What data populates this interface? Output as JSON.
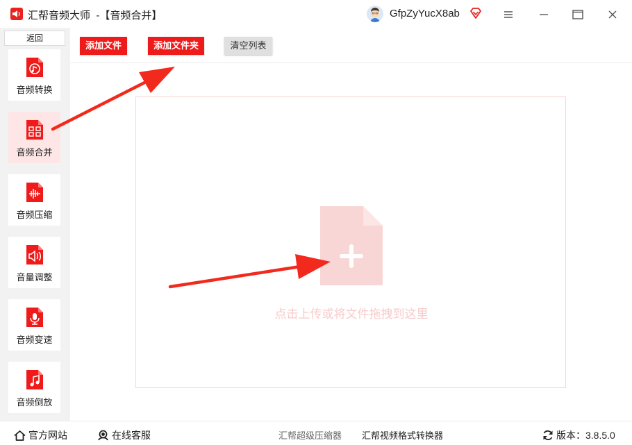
{
  "window": {
    "app_name": "汇帮音频大师",
    "subtitle": "-【音频合并】",
    "username": "GfpZyYucX8ab"
  },
  "sidebar": {
    "back_label": "返回",
    "items": [
      {
        "label": "音频转换",
        "icon": "audio-convert-icon"
      },
      {
        "label": "音频合并",
        "icon": "audio-merge-icon",
        "active": true
      },
      {
        "label": "音频压缩",
        "icon": "audio-compress-icon"
      },
      {
        "label": "音量调整",
        "icon": "volume-adjust-icon"
      },
      {
        "label": "音频变速",
        "icon": "audio-speed-icon"
      },
      {
        "label": "音频倒放",
        "icon": "audio-reverse-icon"
      }
    ]
  },
  "toolbar": {
    "add_file": "添加文件",
    "add_folder": "添加文件夹",
    "clear_list": "清空列表"
  },
  "dropzone": {
    "hint": "点击上传或将文件拖拽到这里"
  },
  "footer": {
    "website": "官方网站",
    "support": "在线客服",
    "compressor": "汇帮超级压缩器",
    "video_converter": "汇帮视频格式转换器",
    "version_label": "版本：3.8.5.0"
  },
  "colors": {
    "accent": "#ef1b1b",
    "active_bg": "#fde6e5",
    "drop_border": "#f5d6d6",
    "drop_hint": "#f7caca"
  }
}
